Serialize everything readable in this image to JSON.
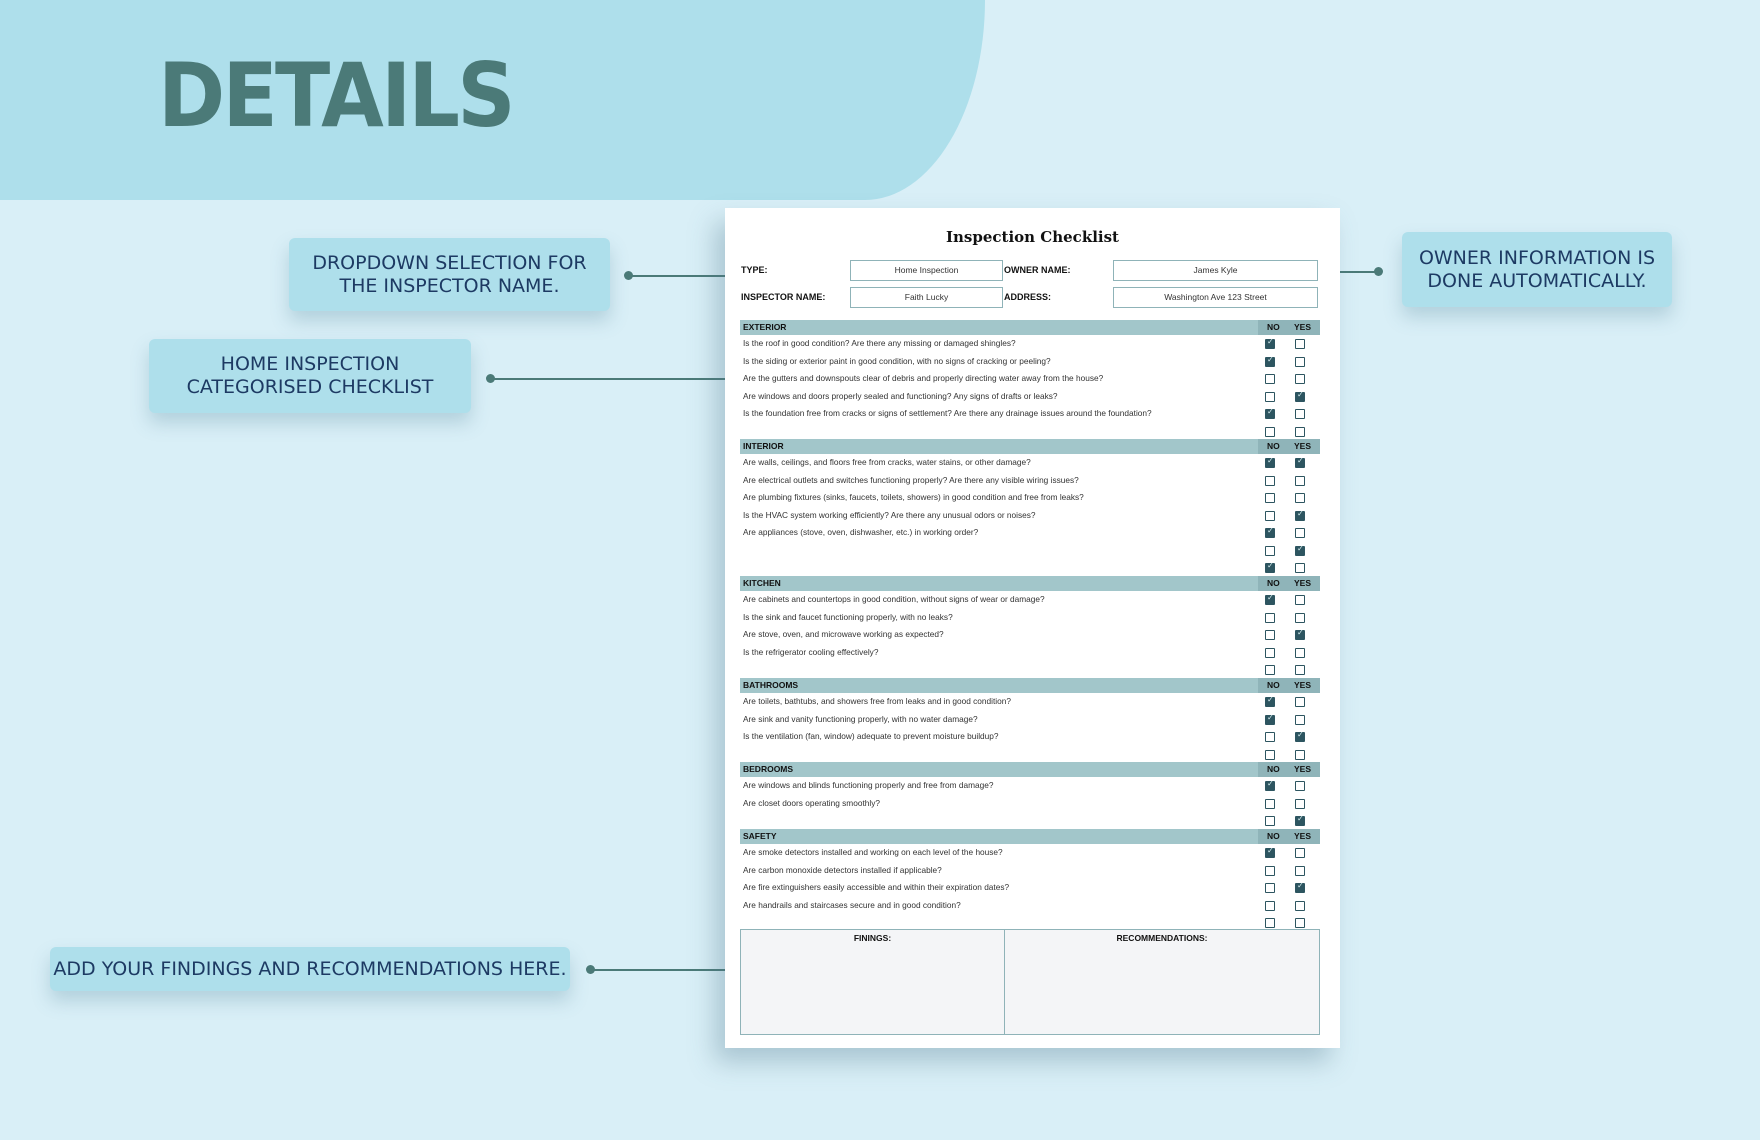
{
  "header": {
    "title": "DETAILS"
  },
  "callouts": {
    "dropdown": [
      "DROPDOWN SELECTION FOR",
      "THE INSPECTOR NAME."
    ],
    "owner": [
      "OWNER INFORMATION IS",
      "DONE AUTOMATICALLY."
    ],
    "checklist": [
      "HOME INSPECTION",
      "CATEGORISED CHECKLIST"
    ],
    "findings": [
      "ADD YOUR FINDINGS AND RECOMMENDATIONS HERE."
    ]
  },
  "colors": {
    "background": "#d9eff7",
    "band": "#aedfeb",
    "accent": "#4b7a78",
    "callout_text": "#1d3a63",
    "section_header": "#a2c6ca",
    "checkbox": "#2d5560"
  },
  "document": {
    "title": "Inspection Checklist",
    "fields": {
      "type_label": "TYPE:",
      "type_value": "Home Inspection",
      "owner_label": "OWNER NAME:",
      "owner_value": "James Kyle",
      "inspector_label": "INSPECTOR NAME:",
      "inspector_value": "Faith Lucky",
      "address_label": "ADDRESS:",
      "address_value": "Washington Ave 123 Street"
    },
    "col_no": "NO",
    "col_yes": "YES",
    "sections": [
      {
        "name": "EXTERIOR",
        "rows": [
          {
            "q": "Is the roof in good condition? Are there any missing or damaged shingles?",
            "no": true,
            "yes": false
          },
          {
            "q": "Is the siding or exterior paint in good condition, with no signs of cracking or peeling?",
            "no": true,
            "yes": false
          },
          {
            "q": "Are the gutters and downspouts clear of debris and properly directing water away from the house?",
            "no": false,
            "yes": false
          },
          {
            "q": "Are windows and doors properly sealed and functioning? Any signs of drafts or leaks?",
            "no": false,
            "yes": true
          },
          {
            "q": "Is the foundation free from cracks or signs of settlement? Are there any drainage issues around the foundation?",
            "no": true,
            "yes": false
          },
          {
            "q": "",
            "no": false,
            "yes": false
          }
        ]
      },
      {
        "name": "INTERIOR",
        "rows": [
          {
            "q": "Are walls, ceilings, and floors free from cracks, water stains, or other damage?",
            "no": true,
            "yes": true
          },
          {
            "q": "Are electrical outlets and switches functioning properly? Are there any visible wiring issues?",
            "no": false,
            "yes": false
          },
          {
            "q": "Are plumbing fixtures (sinks, faucets, toilets, showers) in good condition and free from leaks?",
            "no": false,
            "yes": false
          },
          {
            "q": "Is the HVAC system working efficiently? Are there any unusual odors or noises?",
            "no": false,
            "yes": true
          },
          {
            "q": "Are appliances (stove, oven, dishwasher, etc.) in working order?",
            "no": true,
            "yes": false
          },
          {
            "q": "",
            "no": false,
            "yes": true
          },
          {
            "q": "",
            "no": true,
            "yes": false
          }
        ]
      },
      {
        "name": "KITCHEN",
        "rows": [
          {
            "q": "Are cabinets and countertops in good condition, without signs of wear or damage?",
            "no": true,
            "yes": false
          },
          {
            "q": "Is the sink and faucet functioning properly, with no leaks?",
            "no": false,
            "yes": false
          },
          {
            "q": "Are stove, oven, and microwave working as expected?",
            "no": false,
            "yes": true
          },
          {
            "q": "Is the refrigerator cooling effectively?",
            "no": false,
            "yes": false
          },
          {
            "q": "",
            "no": false,
            "yes": false
          }
        ]
      },
      {
        "name": "BATHROOMS",
        "rows": [
          {
            "q": "Are toilets, bathtubs, and showers free from leaks and in good condition?",
            "no": true,
            "yes": false
          },
          {
            "q": "Are sink and vanity functioning properly, with no water damage?",
            "no": true,
            "yes": false
          },
          {
            "q": "Is the ventilation (fan, window) adequate to prevent moisture buildup?",
            "no": false,
            "yes": true
          },
          {
            "q": "",
            "no": false,
            "yes": false
          }
        ]
      },
      {
        "name": "BEDROOMS",
        "rows": [
          {
            "q": "Are windows and blinds functioning properly and free from damage?",
            "no": true,
            "yes": false
          },
          {
            "q": "Are closet doors operating smoothly?",
            "no": false,
            "yes": false
          },
          {
            "q": "",
            "no": false,
            "yes": true
          }
        ]
      },
      {
        "name": "SAFETY",
        "rows": [
          {
            "q": "Are smoke detectors installed and working on each level of the house?",
            "no": true,
            "yes": false
          },
          {
            "q": "Are carbon monoxide detectors installed if applicable?",
            "no": false,
            "yes": false
          },
          {
            "q": "Are fire extinguishers easily accessible and within their expiration dates?",
            "no": false,
            "yes": true
          },
          {
            "q": "Are handrails and staircases secure and in good condition?",
            "no": false,
            "yes": false
          },
          {
            "q": "",
            "no": false,
            "yes": false
          }
        ]
      }
    ],
    "findings_label": "FININGS:",
    "recommendations_label": "RECOMMENDATIONS:"
  }
}
